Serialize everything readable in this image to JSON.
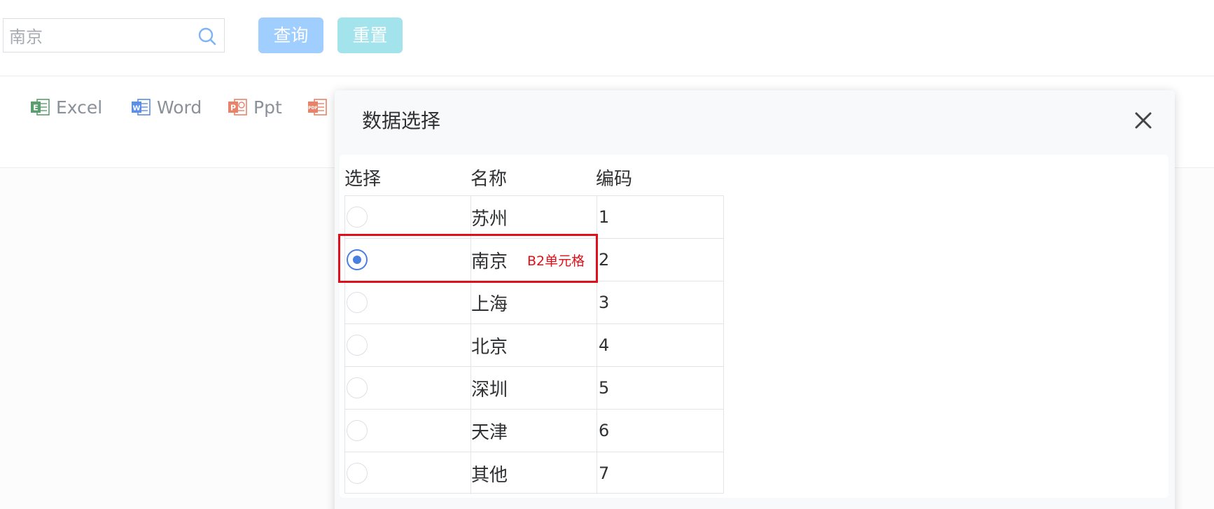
{
  "search": {
    "value": "南京",
    "query_label": "查询",
    "reset_label": "重置"
  },
  "toolbar": {
    "items": [
      {
        "label": "Excel",
        "icon": "excel-icon",
        "color": "#5a9e6f",
        "letter": "E"
      },
      {
        "label": "Word",
        "icon": "word-icon",
        "color": "#5b8ee6",
        "letter": "W"
      },
      {
        "label": "Ppt",
        "icon": "ppt-icon",
        "color": "#e8836a",
        "letter": "P"
      },
      {
        "label": "",
        "icon": "pdf-icon",
        "color": "#e8836a",
        "letter": "PDF"
      }
    ]
  },
  "dialog": {
    "title": "数据选择",
    "columns": [
      "选择",
      "名称",
      "编码"
    ],
    "rows": [
      {
        "name": "苏州",
        "code": "1",
        "selected": false
      },
      {
        "name": "南京",
        "code": "2",
        "selected": true
      },
      {
        "name": "上海",
        "code": "3",
        "selected": false
      },
      {
        "name": "北京",
        "code": "4",
        "selected": false
      },
      {
        "name": "深圳",
        "code": "5",
        "selected": false
      },
      {
        "name": "天津",
        "code": "6",
        "selected": false
      },
      {
        "name": "其他",
        "code": "7",
        "selected": false
      }
    ],
    "annotation": "B2单元格"
  },
  "colors": {
    "query_button": "#a0cfff",
    "reset_button": "#a2e3ec",
    "radio_checked": "#4a7fe0",
    "annotation": "#e0101a"
  }
}
